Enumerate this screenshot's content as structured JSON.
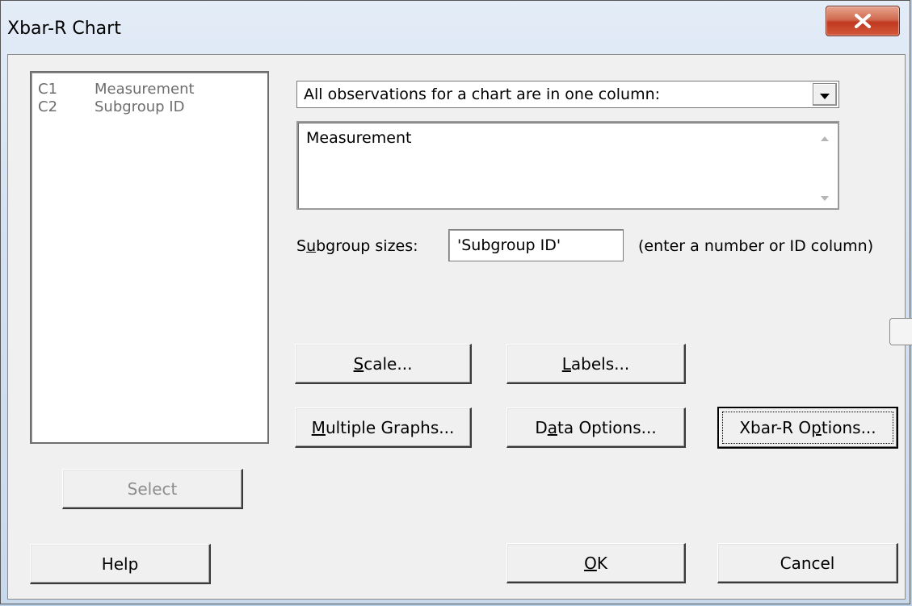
{
  "window": {
    "title": "Xbar-R Chart"
  },
  "variables": [
    {
      "id": "C1",
      "name": "Measurement"
    },
    {
      "id": "C2",
      "name": "Subgroup ID"
    }
  ],
  "data_arrangement": {
    "selected": "All observations for a chart are in one column:"
  },
  "variables_box": {
    "value": "Measurement"
  },
  "subgroup": {
    "label_pre": "S",
    "label_mnemonic": "u",
    "label_post": "bgroup sizes:",
    "value": "'Subgroup ID'",
    "hint": "(enter a number or ID column)"
  },
  "buttons": {
    "scale": {
      "mnemonic": "S",
      "rest": "cale..."
    },
    "labels": {
      "mnemonic": "L",
      "rest": "abels..."
    },
    "multiple_graphs": {
      "mnemonic": "M",
      "rest": "ultiple Graphs..."
    },
    "data_options": {
      "pre": "D",
      "mnemonic": "a",
      "rest": "ta Options..."
    },
    "xbar_r_options": {
      "pre": "Xbar-R O",
      "mnemonic": "p",
      "rest": "tions..."
    },
    "select": "Select",
    "help": "Help",
    "ok": {
      "mnemonic": "O",
      "rest": "K"
    },
    "cancel": "Cancel"
  },
  "icons": {
    "close": "close-icon",
    "dropdown": "chevron-down-icon",
    "scroll_up": "scroll-up-icon",
    "scroll_down": "scroll-down-icon"
  },
  "colors": {
    "dialog_bg": "#f0f0f0",
    "close_button": "#c7432a",
    "disabled_text": "#8d8d8d"
  }
}
